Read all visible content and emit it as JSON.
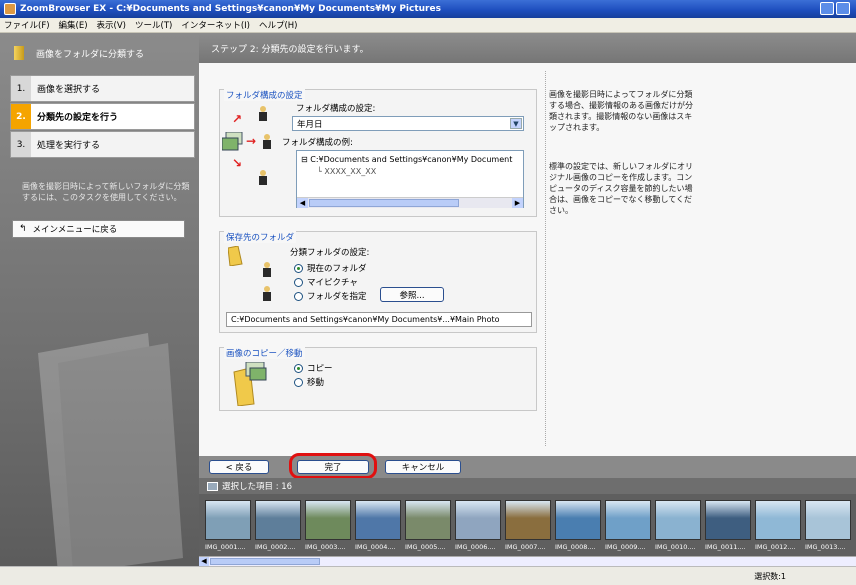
{
  "window": {
    "title": "ZoomBrowser EX  -  C:¥Documents and Settings¥canon¥My Documents¥My Pictures"
  },
  "menu": [
    "ファイル(F)",
    "編集(E)",
    "表示(V)",
    "ツール(T)",
    "インターネット(I)",
    "ヘルプ(H)"
  ],
  "sidebar": {
    "header": "画像をフォルダに分類する",
    "steps": [
      {
        "num": "1.",
        "label": "画像を選択する",
        "state": "inactive"
      },
      {
        "num": "2.",
        "label": "分類先の設定を行う",
        "state": "active"
      },
      {
        "num": "3.",
        "label": "処理を実行する",
        "state": "inactive"
      }
    ],
    "description": "画像を撮影日時によって新しいフォルダに分類するには、このタスクを使用してください。",
    "back_button": "メインメニューに戻る"
  },
  "step_header": "ステップ 2:  分類先の設定を行います。",
  "folder_structure": {
    "group_title": "フォルダ構成の設定",
    "setting_label": "フォルダ構成の設定:",
    "selected": "年月日",
    "example_label": "フォルダ構成の例:",
    "tree_root": "C:¥Documents and Settings¥canon¥My Document",
    "tree_child": "XXXX_XX_XX"
  },
  "destination": {
    "group_title": "保存先のフォルダ",
    "setting_label": "分類フォルダの設定:",
    "options": [
      "現在のフォルダ",
      "マイピクチャ",
      "フォルダを指定"
    ],
    "selected_index": 0,
    "browse_button": "参照...",
    "path": "C:¥Documents and Settings¥canon¥My Documents¥...¥Main Photo"
  },
  "copy_move": {
    "group_title": "画像のコピー／移動",
    "options": [
      "コピー",
      "移動"
    ],
    "selected_index": 0
  },
  "notes": {
    "note1": "画像を撮影日時によってフォルダに分類する場合、撮影情報のある画像だけが分類されます。撮影情報のない画像はスキップされます。",
    "note2": "標準の設定では、新しいフォルダにオリジナル画像のコピーを作成します。コンピュータのディスク容量を節約したい場合は、画像をコピーでなく移動してください。"
  },
  "buttons": {
    "back": "< 戻る",
    "finish": "完了",
    "cancel": "キャンセル"
  },
  "strip": {
    "header": "選択した項目 : 16",
    "thumbnails": [
      {
        "label": "IMG_0001....",
        "color": "#7f9fb6"
      },
      {
        "label": "IMG_0002....",
        "color": "#5e7e9a"
      },
      {
        "label": "IMG_0003....",
        "color": "#6e8a5c"
      },
      {
        "label": "IMG_0004....",
        "color": "#4f77a8"
      },
      {
        "label": "IMG_0005....",
        "color": "#7a8a6a"
      },
      {
        "label": "IMG_0006....",
        "color": "#8fa5bf"
      },
      {
        "label": "IMG_0007....",
        "color": "#8a6e3e"
      },
      {
        "label": "IMG_0008....",
        "color": "#4a7eb0"
      },
      {
        "label": "IMG_0009....",
        "color": "#6fa0c8"
      },
      {
        "label": "IMG_0010....",
        "color": "#8ab2d0"
      },
      {
        "label": "IMG_0011....",
        "color": "#3e5e80"
      },
      {
        "label": "IMG_0012....",
        "color": "#8fb8d6"
      },
      {
        "label": "IMG_0013....",
        "color": "#a8c4d8"
      }
    ]
  },
  "status": "選択数:1",
  "colors": {
    "accent_blue": "#1a52c0",
    "active_step": "#f5a400",
    "highlight_red": "#e01010"
  }
}
